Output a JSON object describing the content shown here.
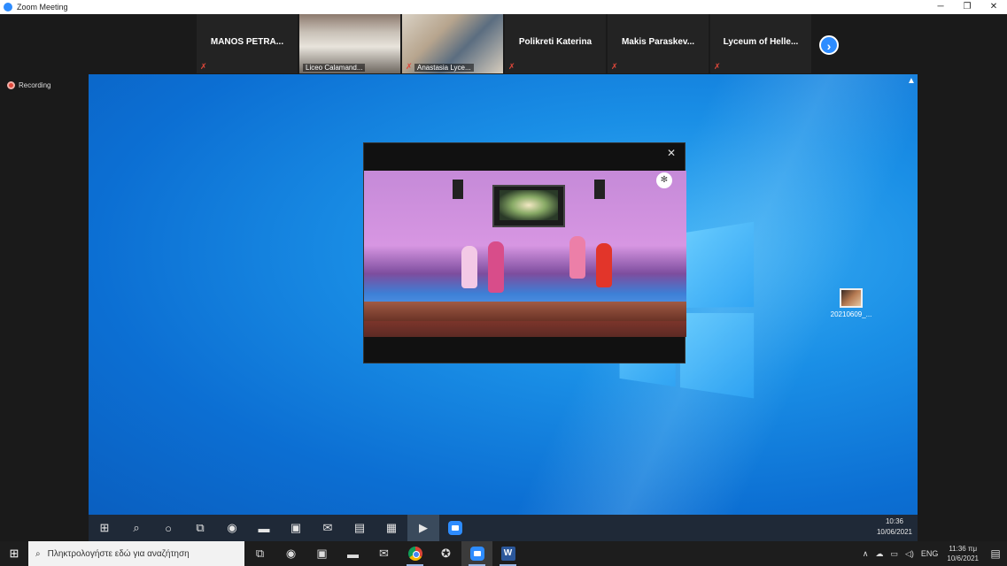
{
  "window": {
    "title": "Zoom Meeting",
    "minimize": "─",
    "restore": "❐",
    "close": "✕"
  },
  "participants": [
    {
      "name": "MANOS PETRA...",
      "video": false
    },
    {
      "name": "Liceo Calamand...",
      "video": true
    },
    {
      "name": "Anastasia Lyce...",
      "video": true
    },
    {
      "name": "Polikreti Katerina",
      "video": false
    },
    {
      "name": "Makis  Paraskev...",
      "video": false
    },
    {
      "name": "Lyceum  of  Helle...",
      "video": false
    }
  ],
  "strip_next": "›",
  "recording_label": "Recording",
  "shared": {
    "desktop_file": "20210609_...",
    "player_close": "✕",
    "taskbar_clock": {
      "time": "10:36",
      "date": "10/06/2021"
    }
  },
  "taskbar": {
    "search_placeholder": "Πληκτρολογήστε εδώ για αναζήτηση",
    "language": "ENG",
    "clock": {
      "time": "11:36 πμ",
      "date": "10/6/2021"
    }
  },
  "icons": {
    "start": "windows-icon",
    "search": "search-icon"
  },
  "colors": {
    "zoom_blue": "#2d8cff",
    "recording_red": "#e0473a",
    "desktop_blue": "#1a8fe6"
  }
}
